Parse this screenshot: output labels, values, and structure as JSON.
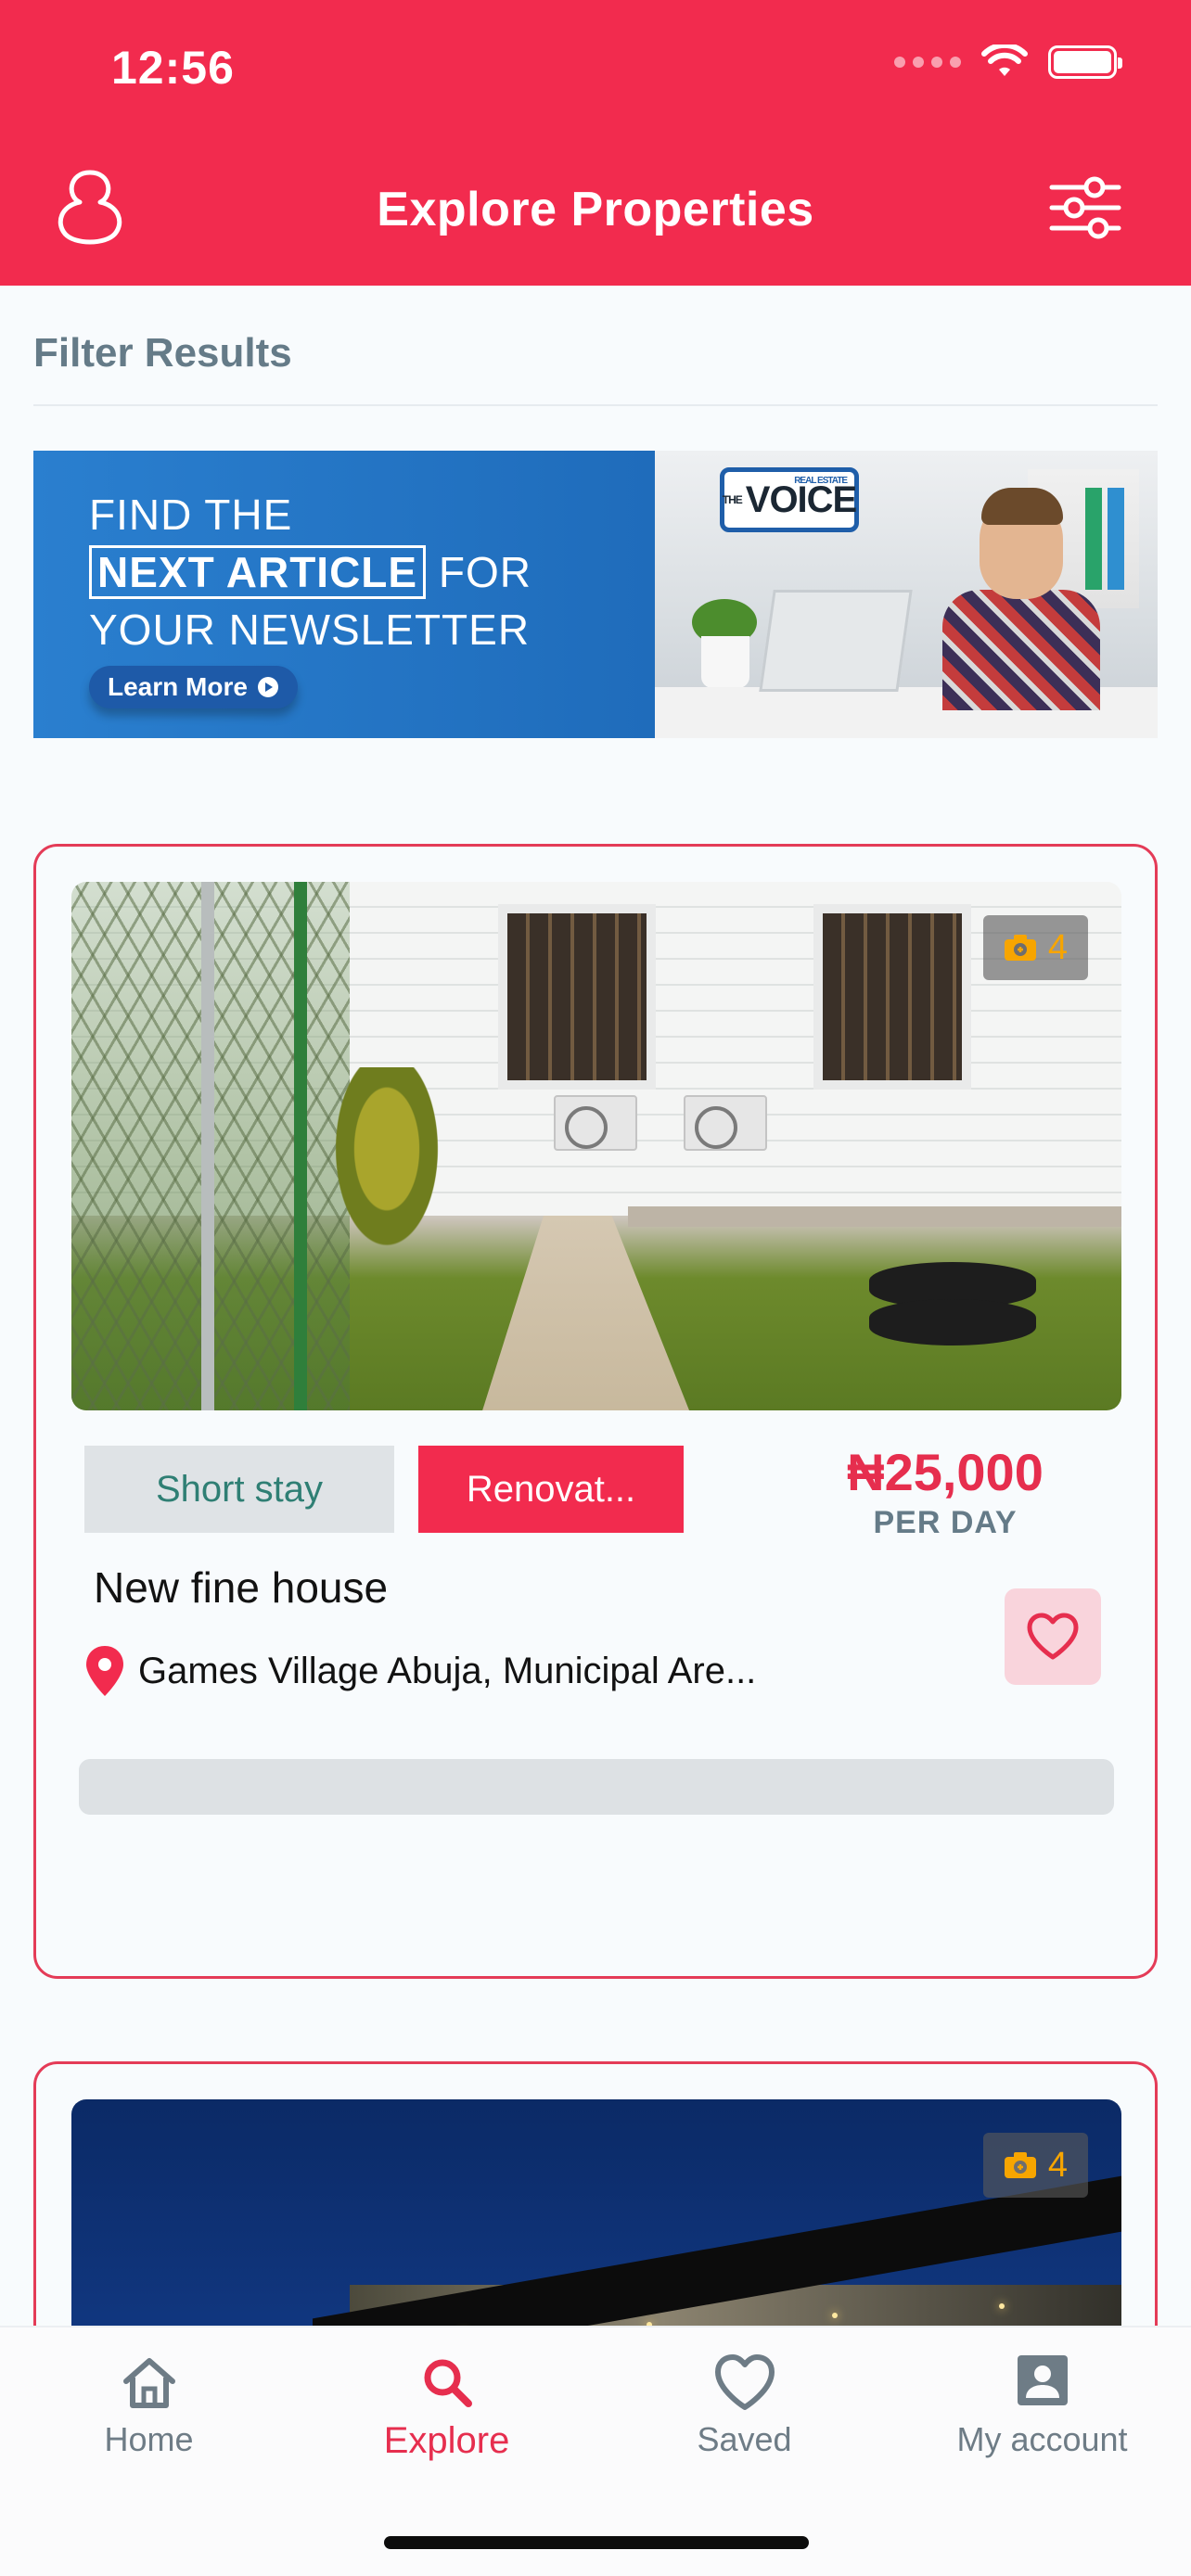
{
  "status_bar": {
    "time": "12:56"
  },
  "header": {
    "title": "Explore Properties"
  },
  "filter": {
    "label": "Filter Results"
  },
  "banner": {
    "line1": "FIND THE",
    "line2_boxed": "NEXT ARTICLE",
    "line2_rest": " FOR",
    "line3": "YOUR NEWSLETTER",
    "cta": "Learn More",
    "brand_small": "THE",
    "brand_tag": "REAL ESTATE",
    "brand": "VOICE"
  },
  "listings": [
    {
      "photo_count": "4",
      "tags": [
        "Short stay",
        "Renovat..."
      ],
      "price": "₦25,000",
      "price_unit": "PER DAY",
      "title": "New fine house",
      "location": "Games Village Abuja, Municipal Are...",
      "progress": 0
    },
    {
      "photo_count": "4"
    }
  ],
  "bottom_nav": {
    "items": [
      {
        "label": "Home",
        "icon": "home-icon"
      },
      {
        "label": "Explore",
        "icon": "search-icon",
        "active": true
      },
      {
        "label": "Saved",
        "icon": "heart-icon"
      },
      {
        "label": "My account",
        "icon": "account-icon"
      }
    ]
  },
  "colors": {
    "brand": "#f22b4e",
    "muted": "#657b88"
  }
}
